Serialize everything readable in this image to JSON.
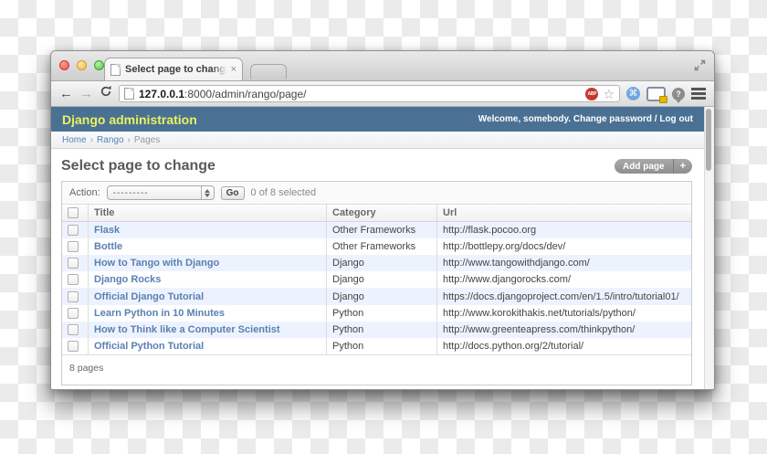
{
  "browser": {
    "tab": {
      "title": "Select page to change | Dj",
      "close_icon": "×"
    },
    "url": {
      "host": "127.0.0.1",
      "rest": ":8000/admin/rango/page/"
    },
    "icons": {
      "back_arrow": "←",
      "forward_arrow": "→",
      "star": "☆",
      "abp_label": "ABP",
      "command_symbol": "⌘",
      "pin_question": "?"
    }
  },
  "admin": {
    "site_title": "Django administration",
    "user_tools": {
      "welcome_prefix": "Welcome,",
      "username": "somebody.",
      "change_password": "Change password",
      "separator": "/",
      "logout": "Log out"
    },
    "breadcrumbs": {
      "separator": "›",
      "items": [
        {
          "label": "Home"
        },
        {
          "label": "Rango"
        },
        {
          "label": "Pages"
        }
      ]
    },
    "page_title": "Select page to change",
    "add_button": {
      "label": "Add page",
      "plus": "+"
    },
    "actions": {
      "label": "Action:",
      "selected_option": "---------",
      "go": "Go",
      "counter": "0 of 8 selected"
    },
    "table": {
      "headers": [
        "Title",
        "Category",
        "Url"
      ],
      "rows": [
        {
          "title": "Flask",
          "category": "Other Frameworks",
          "url": "http://flask.pocoo.org"
        },
        {
          "title": "Bottle",
          "category": "Other Frameworks",
          "url": "http://bottlepy.org/docs/dev/"
        },
        {
          "title": "How to Tango with Django",
          "category": "Django",
          "url": "http://www.tangowithdjango.com/"
        },
        {
          "title": "Django Rocks",
          "category": "Django",
          "url": "http://www.djangorocks.com/"
        },
        {
          "title": "Official Django Tutorial",
          "category": "Django",
          "url": "https://docs.djangoproject.com/en/1.5/intro/tutorial01/"
        },
        {
          "title": "Learn Python in 10 Minutes",
          "category": "Python",
          "url": "http://www.korokithakis.net/tutorials/python/"
        },
        {
          "title": "How to Think like a Computer Scientist",
          "category": "Python",
          "url": "http://www.greenteapress.com/thinkpython/"
        },
        {
          "title": "Official Python Tutorial",
          "category": "Python",
          "url": "http://docs.python.org/2/tutorial/"
        }
      ]
    },
    "paginator": "8 pages"
  },
  "colors": {
    "admin_header_blue": "#4a7194",
    "branding_yellow": "#e9f25e",
    "link_blue": "#5b80b2",
    "row_stripe_blue": "#edf3fe",
    "abp_red": "#c3392e",
    "lock_yellow": "#e6b800",
    "checker_gray": "#ebebeb"
  }
}
